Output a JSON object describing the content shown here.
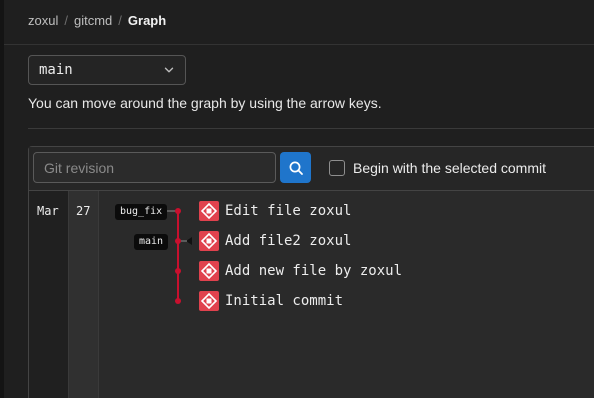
{
  "breadcrumb": {
    "items": [
      "zoxul",
      "gitcmd"
    ],
    "separator": "/",
    "current": "Graph"
  },
  "branch_select": {
    "value": "main",
    "icon": "chevron-down-icon"
  },
  "hint_text": "You can move around the graph by using the arrow keys.",
  "search": {
    "placeholder": "Git revision",
    "value": "",
    "button_icon": "search-icon"
  },
  "checkbox": {
    "label": "Begin with the selected commit",
    "checked": false
  },
  "date": {
    "month": "Mar",
    "day": "27"
  },
  "refs": {
    "bug_fix": "bug_fix",
    "main": "main"
  },
  "commits": [
    {
      "message": "Edit file zoxul",
      "ref": "bug_fix"
    },
    {
      "message": "Add file2 zoxul",
      "ref": "main"
    },
    {
      "message": "Add new file by zoxul",
      "ref": ""
    },
    {
      "message": "Initial commit",
      "ref": ""
    }
  ],
  "colors": {
    "background": "#1f1f1f",
    "graph_line": "#c8102e",
    "search_button": "#1f75cb",
    "avatar": "#e0424e"
  }
}
